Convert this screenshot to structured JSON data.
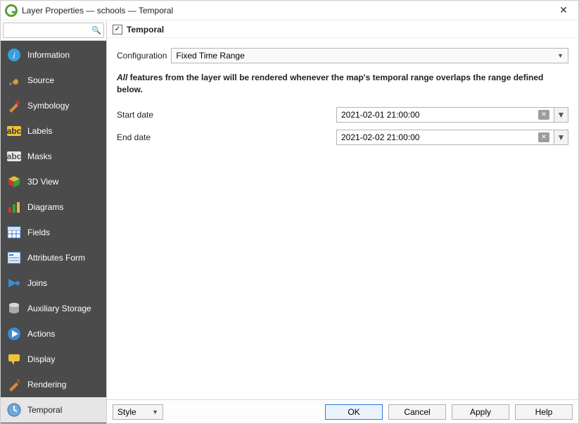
{
  "window": {
    "title": "Layer Properties — schools — Temporal"
  },
  "search": {
    "placeholder": ""
  },
  "sidebar": {
    "items": [
      {
        "label": "Information"
      },
      {
        "label": "Source"
      },
      {
        "label": "Symbology"
      },
      {
        "label": "Labels"
      },
      {
        "label": "Masks"
      },
      {
        "label": "3D View"
      },
      {
        "label": "Diagrams"
      },
      {
        "label": "Fields"
      },
      {
        "label": "Attributes Form"
      },
      {
        "label": "Joins"
      },
      {
        "label": "Auxiliary Storage"
      },
      {
        "label": "Actions"
      },
      {
        "label": "Display"
      },
      {
        "label": "Rendering"
      },
      {
        "label": "Temporal"
      }
    ]
  },
  "header": {
    "checkbox_checked": "✓",
    "label": "Temporal"
  },
  "config": {
    "label": "Configuration",
    "value": "Fixed Time Range"
  },
  "description": {
    "prefix": "All",
    "rest": " features from the layer will be rendered whenever the map's temporal range overlaps the range defined below."
  },
  "fields": {
    "start": {
      "label": "Start date",
      "value": "2021-02-01 21:00:00"
    },
    "end": {
      "label": "End date",
      "value": "2021-02-02 21:00:00"
    }
  },
  "footer": {
    "style": "Style",
    "ok": "OK",
    "cancel": "Cancel",
    "apply": "Apply",
    "help": "Help"
  }
}
